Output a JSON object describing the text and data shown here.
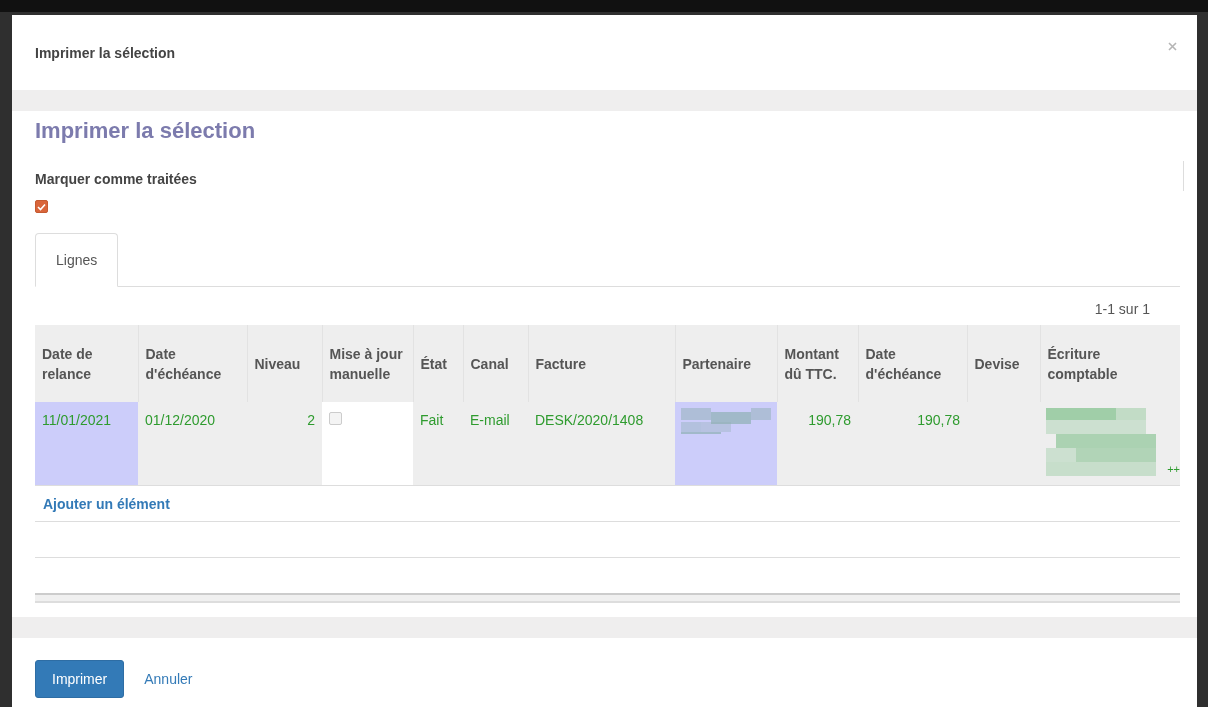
{
  "dialog": {
    "title": "Imprimer la sélection",
    "heading": "Imprimer la sélection"
  },
  "mark_done": {
    "label": "Marquer comme traitées",
    "checked": true
  },
  "tabs": [
    {
      "label": "Lignes",
      "selected": true
    }
  ],
  "pager": "1-1 sur 1",
  "table": {
    "columns": [
      {
        "label": "Date de relance",
        "kind": "text"
      },
      {
        "label": "Date d'échéance",
        "kind": "text"
      },
      {
        "label": "Niveau",
        "kind": "number"
      },
      {
        "label": "Mise à jour manuelle",
        "kind": "checkbox"
      },
      {
        "label": "État",
        "kind": "text"
      },
      {
        "label": "Canal",
        "kind": "text"
      },
      {
        "label": "Facture",
        "kind": "text"
      },
      {
        "label": "Partenaire",
        "kind": "redacted"
      },
      {
        "label": "Montant dû TTC.",
        "kind": "number"
      },
      {
        "label": "Date d'échéance",
        "kind": "number"
      },
      {
        "label": "Devise",
        "kind": "text"
      },
      {
        "label": "Écriture comptable",
        "kind": "redacted"
      }
    ],
    "rows": [
      {
        "cells": [
          {
            "value": "11/01/2021",
            "highlighted": true
          },
          {
            "value": "01/12/2020",
            "highlighted": false
          },
          {
            "value": "2",
            "highlighted": false
          },
          {
            "checked": false,
            "highlighted": false
          },
          {
            "value": "Fait",
            "highlighted": false
          },
          {
            "value": "E-mail",
            "highlighted": false
          },
          {
            "value": "DESK/2020/1408",
            "highlighted": false
          },
          {
            "highlighted": true
          },
          {
            "value": "190,78",
            "highlighted": false
          },
          {
            "value": "190,78",
            "highlighted": false
          },
          {
            "highlighted": false
          },
          {
            "value": "++",
            "highlighted": false
          }
        ]
      }
    ]
  },
  "add_link": "Ajouter un élément",
  "buttons": {
    "primary": "Imprimer",
    "secondary": "Annuler"
  }
}
